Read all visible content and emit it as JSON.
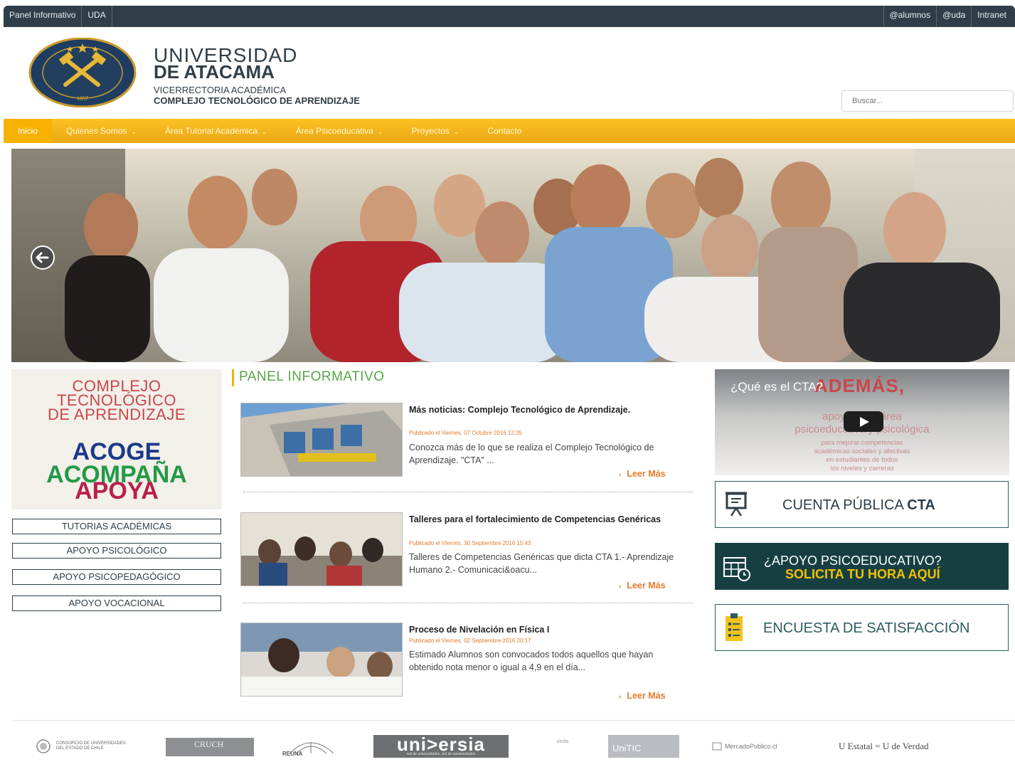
{
  "topbar": {
    "left_links": [
      "Panel Informativo",
      "UDA"
    ],
    "right_links": [
      "@alumnos",
      "@uda",
      "Intranet"
    ]
  },
  "header": {
    "brand_line1": "UNIVERSIDAD",
    "brand_line2": "DE ATACAMA",
    "brand_line3": "VICERRECTORIA ACADÉMICA",
    "brand_line4": "COMPLEJO TECNOLÓGICO DE APRENDIZAJE",
    "logo_year": "1857",
    "search_placeholder": "Buscar..."
  },
  "nav": {
    "items": [
      {
        "label": "Inicio",
        "dropdown": false,
        "active": true
      },
      {
        "label": "Quienes Somos",
        "dropdown": true,
        "active": false
      },
      {
        "label": "Área Tutorial Académica",
        "dropdown": true,
        "active": false
      },
      {
        "label": "Área Psicoeducativa",
        "dropdown": true,
        "active": false
      },
      {
        "label": "Proyectos",
        "dropdown": true,
        "active": false
      },
      {
        "label": "Contacto",
        "dropdown": false,
        "active": false
      }
    ],
    "chevron": "⌄"
  },
  "left": {
    "promo_title": [
      "COMPLEJO",
      "TECNOLÓGICO",
      "DE APRENDIZAJE"
    ],
    "promo_words": [
      "ACOGE",
      "ACOMPAÑA",
      "APOYA"
    ],
    "buttons": [
      "TUTORIAS ACADÉMICAS",
      "APOYO PSICOLÓGICO",
      "APOYO PSICOPEDAGÓGICO",
      "APOYO VOCACIONAL"
    ]
  },
  "panel": {
    "title": "PANEL INFORMATIVO",
    "read_more": "Leer Más",
    "news": [
      {
        "title": "Más noticias: Complejo Tecnológico de Aprendizaje.",
        "date": "Publicado el Viernes, 07 Octubre 2016 12:35",
        "desc": "Conozca más de lo que se realiza el Complejo Tecnológico de Aprendizaje. \"CTA\" ..."
      },
      {
        "title": "Talleres para el fortalecimiento de Competencias Genéricas",
        "date": "Publicado el Viernes, 30 Septiembre 2016 15:43",
        "desc": "Talleres de Competencias Genéricas que dicta CTA 1.- Aprendizaje Humano 2.- Comunicaci&oacu..."
      },
      {
        "title": "Proceso de Nivelación en Física I",
        "date": "Publicado el Viernes, 02 Septiembre 2016 20:17",
        "desc": "Estimado Alumnos son convocados todos aquellos que hayan obtenido nota menor o igual a 4,9 en el día..."
      }
    ]
  },
  "right": {
    "video_title": "¿Qué es el CTA?",
    "video_word": "ADEMÁS,",
    "video_lines": [
      "apoyo en el área",
      "psicoeducativa y psicológica"
    ],
    "video_small": [
      "para mejorar competencias",
      "académicas sociales y afectivas",
      "en estudiantes de todos",
      "los niveles y carreras"
    ],
    "cuenta_label": "CUENTA PÚBLICA",
    "cuenta_bold": "CTA",
    "apoyo_line1": "¿APOYO PSICOEDUCATIVO?",
    "apoyo_line2": "SOLICITA TU HORA AQUÍ",
    "encuesta": "ENCUESTA DE SATISFACCIÓN"
  },
  "footer": {
    "consorcio": [
      "CONSORCIO DE UNIVERSIDADES",
      "DEL ESTADO DE CHILE"
    ],
    "cruch": "CRUCH",
    "reuna": "REUNA",
    "universia": "uni>ersia",
    "universia_sub": "red de universidades, red de oportunidades",
    "cinda": "cinda",
    "unitic": "UniTIC",
    "mercado": "MercadoPublico.cl",
    "estatal": "U Estatal = U de Verdad"
  },
  "colors": {
    "topbar": "#2f3e48",
    "nav": "#f3b414",
    "panel_title": "#56a845",
    "date": "#e37a2a",
    "dark_teal": "#173f42",
    "gold": "#f5c200"
  }
}
